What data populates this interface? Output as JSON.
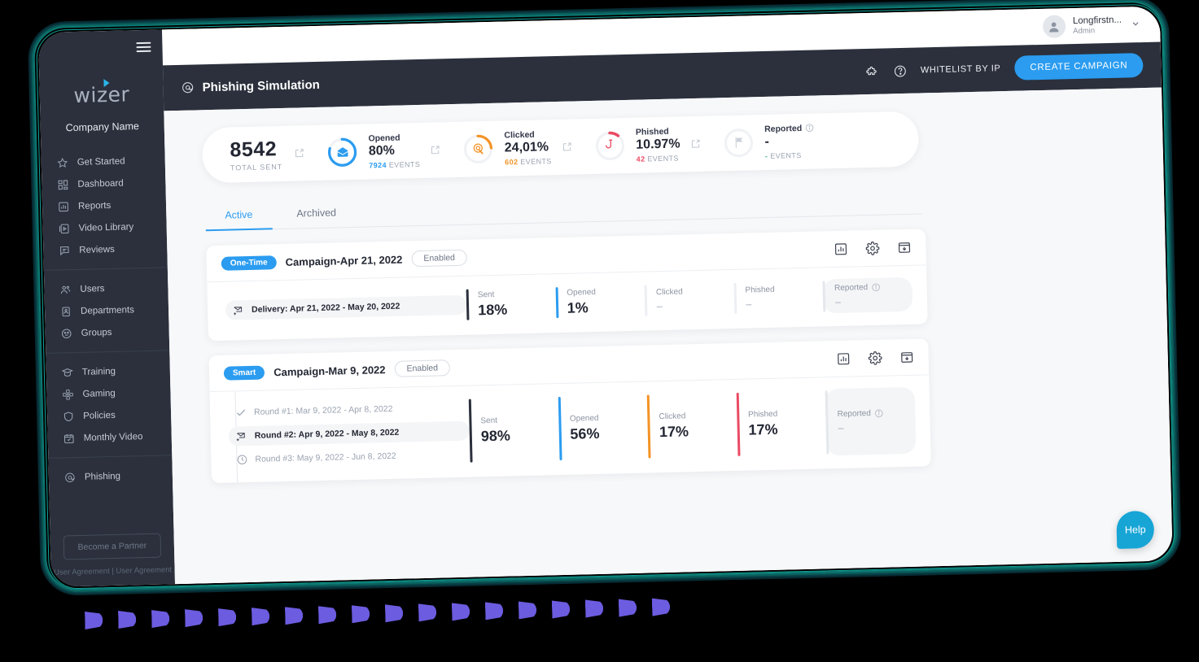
{
  "sidebar": {
    "brand": "wizer",
    "company": "Company Name",
    "groups": [
      {
        "items": [
          {
            "label": "Get Started",
            "icon": "star-icon"
          },
          {
            "label": "Dashboard",
            "icon": "dashboard-icon"
          },
          {
            "label": "Reports",
            "icon": "report-chart-icon"
          },
          {
            "label": "Video Library",
            "icon": "video-icon"
          },
          {
            "label": "Reviews",
            "icon": "reviews-icon"
          }
        ]
      },
      {
        "items": [
          {
            "label": "Users",
            "icon": "users-icon"
          },
          {
            "label": "Departments",
            "icon": "departments-icon"
          },
          {
            "label": "Groups",
            "icon": "groups-icon"
          }
        ]
      },
      {
        "items": [
          {
            "label": "Training",
            "icon": "graduation-cap-icon"
          },
          {
            "label": "Gaming",
            "icon": "gamepad-icon"
          },
          {
            "label": "Policies",
            "icon": "shield-icon"
          },
          {
            "label": "Monthly Video",
            "icon": "calendar-check-icon"
          }
        ]
      },
      {
        "items": [
          {
            "label": "Phishing",
            "icon": "at-icon"
          }
        ]
      }
    ],
    "partner_button": "Become a Partner",
    "agreement": "User Agreement | User Agreement"
  },
  "topbar": {
    "user_name": "Longfirstn...",
    "user_role": "Admin",
    "chevron": "⌄"
  },
  "pagebar": {
    "title": "Phishing Simulation",
    "whitelist_label": "WHITELIST BY IP",
    "create_label": "CREATE CAMPAIGN",
    "accent": "#2b9cf0"
  },
  "stats": {
    "total": {
      "value": "8542",
      "label": "TOTAL SENT"
    },
    "items": [
      {
        "name": "Opened",
        "value": "80%",
        "events_num": "7924",
        "events_label": "EVENTS",
        "color": "#2b9cf0",
        "pct": 80,
        "icon": "open-envelope-icon"
      },
      {
        "name": "Clicked",
        "value": "24,01%",
        "events_num": "602",
        "events_label": "EVENTS",
        "color": "#f39325",
        "pct": 24,
        "icon": "click-target-icon"
      },
      {
        "name": "Phished",
        "value": "10.97%",
        "events_num": "42",
        "events_label": "EVENTS",
        "color": "#ea4b64",
        "pct": 11,
        "icon": "fish-hook-icon"
      },
      {
        "name": "Reported",
        "value": "-",
        "events_num": "-",
        "events_label": "EVENTS",
        "color": "#cfd4dc",
        "pct": 0,
        "icon": "flag-icon",
        "has_info": true
      }
    ]
  },
  "tabs": [
    {
      "label": "Active",
      "active": true
    },
    {
      "label": "Archived",
      "active": false
    }
  ],
  "campaigns": [
    {
      "badge": "One-Time",
      "name": "Campaign-Apr 21, 2022",
      "status": "Enabled",
      "actions": [
        "report-chart-icon",
        "gear-icon",
        "archive-icon"
      ],
      "rounds": [
        {
          "label": "Delivery: Apr 21, 2022 - May 20, 2022",
          "icon": "envelope-send-icon",
          "state": "current"
        }
      ],
      "metrics": [
        {
          "label": "Sent",
          "value": "18%",
          "color": "#2b303c"
        },
        {
          "label": "Opened",
          "value": "1%",
          "color": "#2b9cf0"
        },
        {
          "label": "Clicked",
          "value": "–",
          "color": "#eceff3"
        },
        {
          "label": "Phished",
          "value": "–",
          "color": "#eceff3"
        },
        {
          "label": "Reported",
          "value": "–",
          "color": "#eceff3",
          "has_info": true
        }
      ]
    },
    {
      "badge": "Smart",
      "name": "Campaign-Mar 9, 2022",
      "status": "Enabled",
      "actions": [
        "report-chart-icon",
        "gear-icon",
        "archive-icon"
      ],
      "rounds": [
        {
          "label": "Round #1: Mar 9, 2022 - Apr 8, 2022",
          "icon": "check-icon",
          "state": "done"
        },
        {
          "label": "Round #2: Apr 9, 2022 - May 8, 2022",
          "icon": "envelope-send-icon",
          "state": "current"
        },
        {
          "label": "Round #3: May 9, 2022 - Jun 8, 2022",
          "icon": "clock-icon",
          "state": "pending"
        }
      ],
      "metrics": [
        {
          "label": "Sent",
          "value": "98%",
          "color": "#2b303c"
        },
        {
          "label": "Opened",
          "value": "56%",
          "color": "#2b9cf0"
        },
        {
          "label": "Clicked",
          "value": "17%",
          "color": "#f39325"
        },
        {
          "label": "Phished",
          "value": "17%",
          "color": "#ea4b64"
        },
        {
          "label": "Reported",
          "value": "–",
          "color": "#eceff3",
          "has_info": true
        }
      ]
    }
  ],
  "help": {
    "label": "Help",
    "color": "#17a5d6"
  },
  "decor": {
    "dot_color": "#6c5ce0",
    "dot_count": 18
  }
}
